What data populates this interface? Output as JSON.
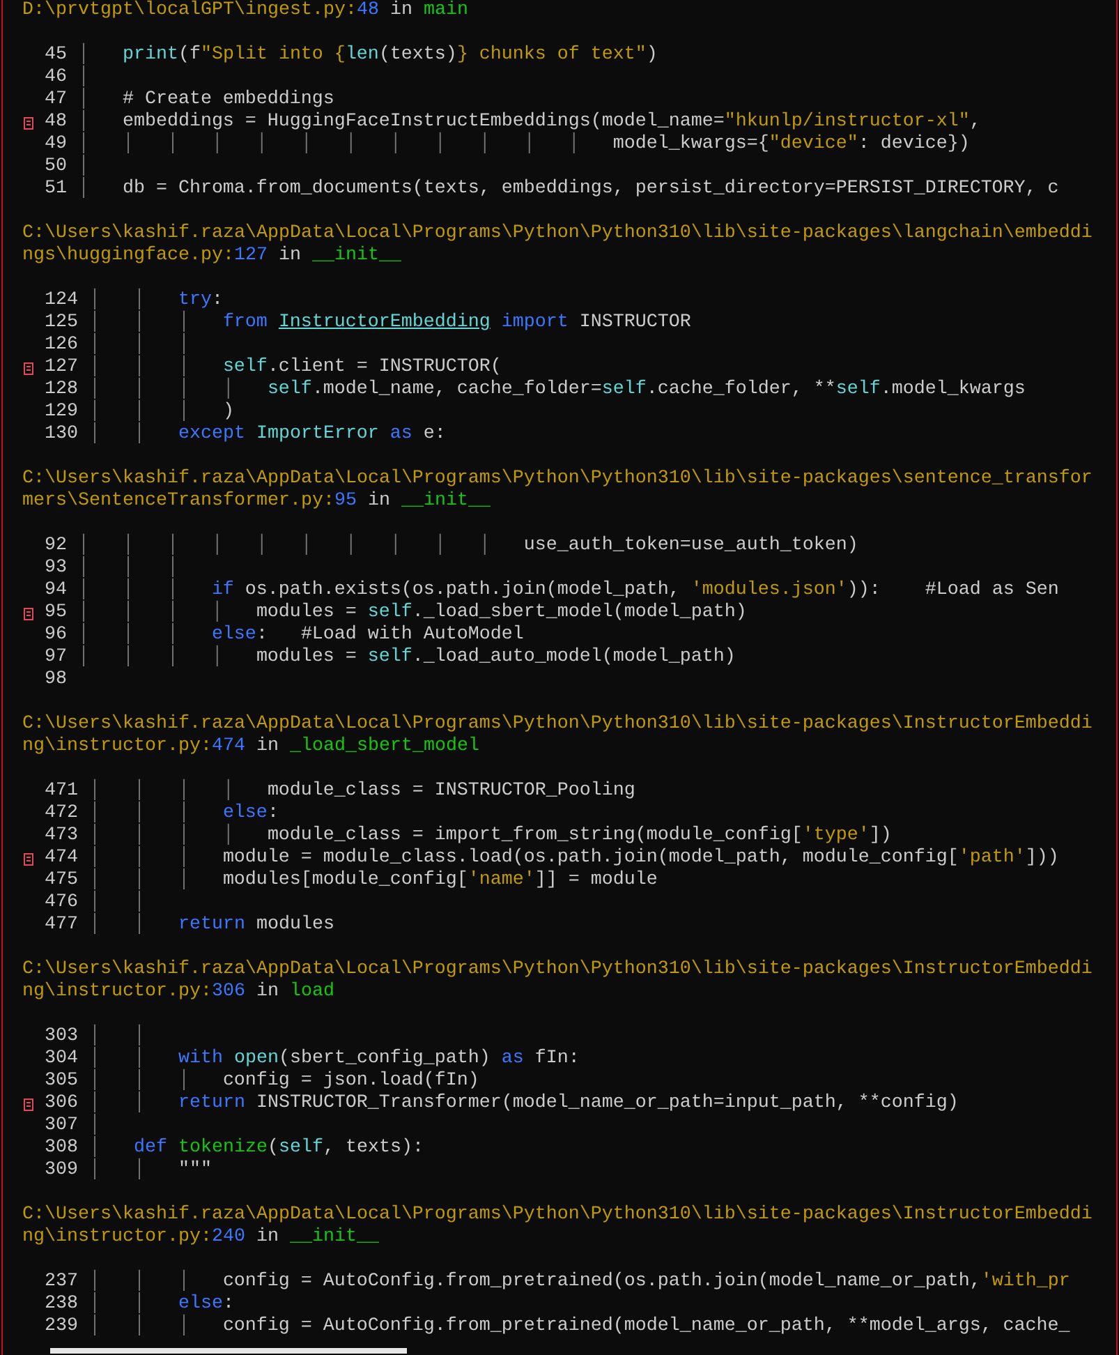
{
  "frames": [
    {
      "location": [
        {
          "text": "D:\\prvtgpt\\localGPT\\ingest.py:",
          "kind": "path"
        },
        {
          "text": "48",
          "kind": "lineno"
        },
        {
          "text": " in ",
          "kind": "plain"
        },
        {
          "text": "main",
          "kind": "func"
        }
      ],
      "lines": [
        {
          "number": "45",
          "error": false,
          "tokens": [
            {
              "text": "│   ",
              "kind": "guide"
            },
            {
              "text": "print",
              "kind": "builtin"
            },
            {
              "text": "(f",
              "kind": "plain"
            },
            {
              "text": "\"Split into {",
              "kind": "string"
            },
            {
              "text": "len",
              "kind": "builtin"
            },
            {
              "text": "(texts)",
              "kind": "plain"
            },
            {
              "text": "} chunks of text\"",
              "kind": "string"
            },
            {
              "text": ")",
              "kind": "plain"
            }
          ]
        },
        {
          "number": "46",
          "error": false,
          "tokens": [
            {
              "text": "│",
              "kind": "guide"
            }
          ]
        },
        {
          "number": "47",
          "error": false,
          "tokens": [
            {
              "text": "│   ",
              "kind": "guide"
            },
            {
              "text": "# Create embeddings",
              "kind": "comment"
            }
          ]
        },
        {
          "number": "48",
          "error": true,
          "tokens": [
            {
              "text": "│   ",
              "kind": "guide"
            },
            {
              "text": "embeddings = HuggingFaceInstructEmbeddings(model_name=",
              "kind": "plain"
            },
            {
              "text": "\"hkunlp/instructor-xl\"",
              "kind": "string"
            },
            {
              "text": ",",
              "kind": "plain"
            }
          ]
        },
        {
          "number": "49",
          "error": false,
          "tokens": [
            {
              "text": "│   │   │   │   │   │   │   │   │   │   │   │   ",
              "kind": "guide"
            },
            {
              "text": "model_kwargs={",
              "kind": "plain"
            },
            {
              "text": "\"device\"",
              "kind": "string"
            },
            {
              "text": ": device})",
              "kind": "plain"
            }
          ]
        },
        {
          "number": "50",
          "error": false,
          "tokens": [
            {
              "text": "│",
              "kind": "guide"
            }
          ]
        },
        {
          "number": "51",
          "error": false,
          "tokens": [
            {
              "text": "│   ",
              "kind": "guide"
            },
            {
              "text": "db = Chroma.from_documents(texts, embeddings, persist_directory=PERSIST_DIRECTORY, c",
              "kind": "plain"
            }
          ]
        }
      ]
    },
    {
      "location": [
        {
          "text": "C:\\Users\\kashif.raza\\AppData\\Local\\Programs\\Python\\Python310\\lib\\site-packages\\langchain\\embeddings\\huggingface.py:",
          "kind": "path"
        },
        {
          "text": "127",
          "kind": "lineno"
        },
        {
          "text": " in ",
          "kind": "plain"
        },
        {
          "text": "__init__",
          "kind": "func"
        }
      ],
      "lines": [
        {
          "number": "124",
          "error": false,
          "tokens": [
            {
              "text": "│   │   ",
              "kind": "guide"
            },
            {
              "text": "try",
              "kind": "keyword"
            },
            {
              "text": ":",
              "kind": "plain"
            }
          ]
        },
        {
          "number": "125",
          "error": false,
          "tokens": [
            {
              "text": "│   │   │   ",
              "kind": "guide"
            },
            {
              "text": "from ",
              "kind": "keyword"
            },
            {
              "text": "InstructorEmbedding",
              "kind": "module"
            },
            {
              "text": " import",
              "kind": "keyword"
            },
            {
              "text": " INSTRUCTOR",
              "kind": "plain"
            }
          ]
        },
        {
          "number": "126",
          "error": false,
          "tokens": [
            {
              "text": "│   │   │",
              "kind": "guide"
            }
          ]
        },
        {
          "number": "127",
          "error": true,
          "tokens": [
            {
              "text": "│   │   │   ",
              "kind": "guide"
            },
            {
              "text": "self",
              "kind": "builtin"
            },
            {
              "text": ".client = INSTRUCTOR(",
              "kind": "plain"
            }
          ]
        },
        {
          "number": "128",
          "error": false,
          "tokens": [
            {
              "text": "│   │   │   │   ",
              "kind": "guide"
            },
            {
              "text": "self",
              "kind": "builtin"
            },
            {
              "text": ".model_name, cache_folder=",
              "kind": "plain"
            },
            {
              "text": "self",
              "kind": "builtin"
            },
            {
              "text": ".cache_folder, **",
              "kind": "plain"
            },
            {
              "text": "self",
              "kind": "builtin"
            },
            {
              "text": ".model_kwargs",
              "kind": "plain"
            }
          ]
        },
        {
          "number": "129",
          "error": false,
          "tokens": [
            {
              "text": "│   │   │   ",
              "kind": "guide"
            },
            {
              "text": ")",
              "kind": "plain"
            }
          ]
        },
        {
          "number": "130",
          "error": false,
          "tokens": [
            {
              "text": "│   │   ",
              "kind": "guide"
            },
            {
              "text": "except ",
              "kind": "keyword"
            },
            {
              "text": "ImportError",
              "kind": "builtin"
            },
            {
              "text": " as",
              "kind": "keyword"
            },
            {
              "text": " e:",
              "kind": "plain"
            }
          ]
        }
      ]
    },
    {
      "location": [
        {
          "text": "C:\\Users\\kashif.raza\\AppData\\Local\\Programs\\Python\\Python310\\lib\\site-packages\\sentence_transformers\\SentenceTransformer.py:",
          "kind": "path"
        },
        {
          "text": "95",
          "kind": "lineno"
        },
        {
          "text": " in ",
          "kind": "plain"
        },
        {
          "text": "__init__",
          "kind": "func"
        }
      ],
      "lines": [
        {
          "number": "92",
          "error": false,
          "tokens": [
            {
              "text": "│   │   │   │   │   │   │   │   │   │   ",
              "kind": "guide"
            },
            {
              "text": "use_auth_token=use_auth_token)",
              "kind": "plain"
            }
          ]
        },
        {
          "number": "93",
          "error": false,
          "tokens": [
            {
              "text": "│   │   │",
              "kind": "guide"
            }
          ]
        },
        {
          "number": "94",
          "error": false,
          "tokens": [
            {
              "text": "│   │   │   ",
              "kind": "guide"
            },
            {
              "text": "if",
              "kind": "keyword"
            },
            {
              "text": " os.path.exists(os.path.join(model_path, ",
              "kind": "plain"
            },
            {
              "text": "'modules.json'",
              "kind": "string"
            },
            {
              "text": ")):    ",
              "kind": "plain"
            },
            {
              "text": "#Load as Sen",
              "kind": "comment"
            }
          ]
        },
        {
          "number": "95",
          "error": true,
          "tokens": [
            {
              "text": "│   │   │   │   ",
              "kind": "guide"
            },
            {
              "text": "modules = ",
              "kind": "plain"
            },
            {
              "text": "self",
              "kind": "builtin"
            },
            {
              "text": "._load_sbert_model(model_path)",
              "kind": "plain"
            }
          ]
        },
        {
          "number": "96",
          "error": false,
          "tokens": [
            {
              "text": "│   │   │   ",
              "kind": "guide"
            },
            {
              "text": "else",
              "kind": "keyword"
            },
            {
              "text": ":   ",
              "kind": "plain"
            },
            {
              "text": "#Load with AutoModel",
              "kind": "comment"
            }
          ]
        },
        {
          "number": "97",
          "error": false,
          "tokens": [
            {
              "text": "│   │   │   │   ",
              "kind": "guide"
            },
            {
              "text": "modules = ",
              "kind": "plain"
            },
            {
              "text": "self",
              "kind": "builtin"
            },
            {
              "text": "._load_auto_model(model_path)",
              "kind": "plain"
            }
          ]
        },
        {
          "number": "98",
          "error": false
        }
      ]
    },
    {
      "location": [
        {
          "text": "C:\\Users\\kashif.raza\\AppData\\Local\\Programs\\Python\\Python310\\lib\\site-packages\\InstructorEmbedding\\instructor.py:",
          "kind": "path"
        },
        {
          "text": "474",
          "kind": "lineno"
        },
        {
          "text": " in ",
          "kind": "plain"
        },
        {
          "text": "_load_sbert_model",
          "kind": "func"
        }
      ],
      "lines": [
        {
          "number": "471",
          "error": false,
          "tokens": [
            {
              "text": "│   │   │   │   ",
              "kind": "guide"
            },
            {
              "text": "module_class = INSTRUCTOR_Pooling",
              "kind": "plain"
            }
          ]
        },
        {
          "number": "472",
          "error": false,
          "tokens": [
            {
              "text": "│   │   │   ",
              "kind": "guide"
            },
            {
              "text": "else",
              "kind": "keyword"
            },
            {
              "text": ":",
              "kind": "plain"
            }
          ]
        },
        {
          "number": "473",
          "error": false,
          "tokens": [
            {
              "text": "│   │   │   │   ",
              "kind": "guide"
            },
            {
              "text": "module_class = import_from_string(module_config[",
              "kind": "plain"
            },
            {
              "text": "'type'",
              "kind": "string"
            },
            {
              "text": "])",
              "kind": "plain"
            }
          ]
        },
        {
          "number": "474",
          "error": true,
          "tokens": [
            {
              "text": "│   │   │   ",
              "kind": "guide"
            },
            {
              "text": "module = module_class.load(os.path.join(model_path, module_config[",
              "kind": "plain"
            },
            {
              "text": "'path'",
              "kind": "string"
            },
            {
              "text": "]))",
              "kind": "plain"
            }
          ]
        },
        {
          "number": "475",
          "error": false,
          "tokens": [
            {
              "text": "│   │   │   ",
              "kind": "guide"
            },
            {
              "text": "modules[module_config[",
              "kind": "plain"
            },
            {
              "text": "'name'",
              "kind": "string"
            },
            {
              "text": "]] = module",
              "kind": "plain"
            }
          ]
        },
        {
          "number": "476",
          "error": false,
          "tokens": [
            {
              "text": "│   │",
              "kind": "guide"
            }
          ]
        },
        {
          "number": "477",
          "error": false,
          "tokens": [
            {
              "text": "│   │   ",
              "kind": "guide"
            },
            {
              "text": "return",
              "kind": "keyword"
            },
            {
              "text": " modules",
              "kind": "plain"
            }
          ]
        }
      ]
    },
    {
      "location": [
        {
          "text": "C:\\Users\\kashif.raza\\AppData\\Local\\Programs\\Python\\Python310\\lib\\site-packages\\InstructorEmbedding\\instructor.py:",
          "kind": "path"
        },
        {
          "text": "306",
          "kind": "lineno"
        },
        {
          "text": " in ",
          "kind": "plain"
        },
        {
          "text": "load",
          "kind": "func"
        }
      ],
      "lines": [
        {
          "number": "303",
          "error": false,
          "tokens": [
            {
              "text": "│   │",
              "kind": "guide"
            }
          ]
        },
        {
          "number": "304",
          "error": false,
          "tokens": [
            {
              "text": "│   │   ",
              "kind": "guide"
            },
            {
              "text": "with ",
              "kind": "keyword"
            },
            {
              "text": "open",
              "kind": "builtin"
            },
            {
              "text": "(sbert_config_path) ",
              "kind": "plain"
            },
            {
              "text": "as",
              "kind": "keyword"
            },
            {
              "text": " fIn:",
              "kind": "plain"
            }
          ]
        },
        {
          "number": "305",
          "error": false,
          "tokens": [
            {
              "text": "│   │   │   ",
              "kind": "guide"
            },
            {
              "text": "config = json.load(fIn)",
              "kind": "plain"
            }
          ]
        },
        {
          "number": "306",
          "error": true,
          "tokens": [
            {
              "text": "│   │   ",
              "kind": "guide"
            },
            {
              "text": "return",
              "kind": "keyword"
            },
            {
              "text": " INSTRUCTOR_Transformer(model_name_or_path=input_path, **config)",
              "kind": "plain"
            }
          ]
        },
        {
          "number": "307",
          "error": false,
          "tokens": [
            {
              "text": "│",
              "kind": "guide"
            }
          ]
        },
        {
          "number": "308",
          "error": false,
          "tokens": [
            {
              "text": "│   ",
              "kind": "guide"
            },
            {
              "text": "def ",
              "kind": "keyword"
            },
            {
              "text": "tokenize",
              "kind": "func"
            },
            {
              "text": "(",
              "kind": "plain"
            },
            {
              "text": "self",
              "kind": "builtin"
            },
            {
              "text": ", texts):",
              "kind": "plain"
            }
          ]
        },
        {
          "number": "309",
          "error": false,
          "tokens": [
            {
              "text": "│   │   ",
              "kind": "guide"
            },
            {
              "text": "\"\"\"",
              "kind": "plain"
            }
          ]
        }
      ]
    },
    {
      "location": [
        {
          "text": "C:\\Users\\kashif.raza\\AppData\\Local\\Programs\\Python\\Python310\\lib\\site-packages\\InstructorEmbedding\\instructor.py:",
          "kind": "path"
        },
        {
          "text": "240",
          "kind": "lineno"
        },
        {
          "text": " in ",
          "kind": "plain"
        },
        {
          "text": "__init__",
          "kind": "func"
        }
      ],
      "lines": [
        {
          "number": "237",
          "error": false,
          "tokens": [
            {
              "text": "│   │   │   ",
              "kind": "guide"
            },
            {
              "text": "config = AutoConfig.from_pretrained(os.path.join(model_name_or_path,",
              "kind": "plain"
            },
            {
              "text": "'with_pr",
              "kind": "string"
            }
          ]
        },
        {
          "number": "238",
          "error": false,
          "tokens": [
            {
              "text": "│   │   ",
              "kind": "guide"
            },
            {
              "text": "else",
              "kind": "keyword"
            },
            {
              "text": ":",
              "kind": "plain"
            }
          ]
        },
        {
          "number": "239",
          "error": false,
          "tokens": [
            {
              "text": "│   │   │   ",
              "kind": "guide"
            },
            {
              "text": "config = AutoConfig.from_pretrained(model_name_or_path, **model_args, cache_",
              "kind": "plain"
            }
          ]
        }
      ]
    }
  ]
}
